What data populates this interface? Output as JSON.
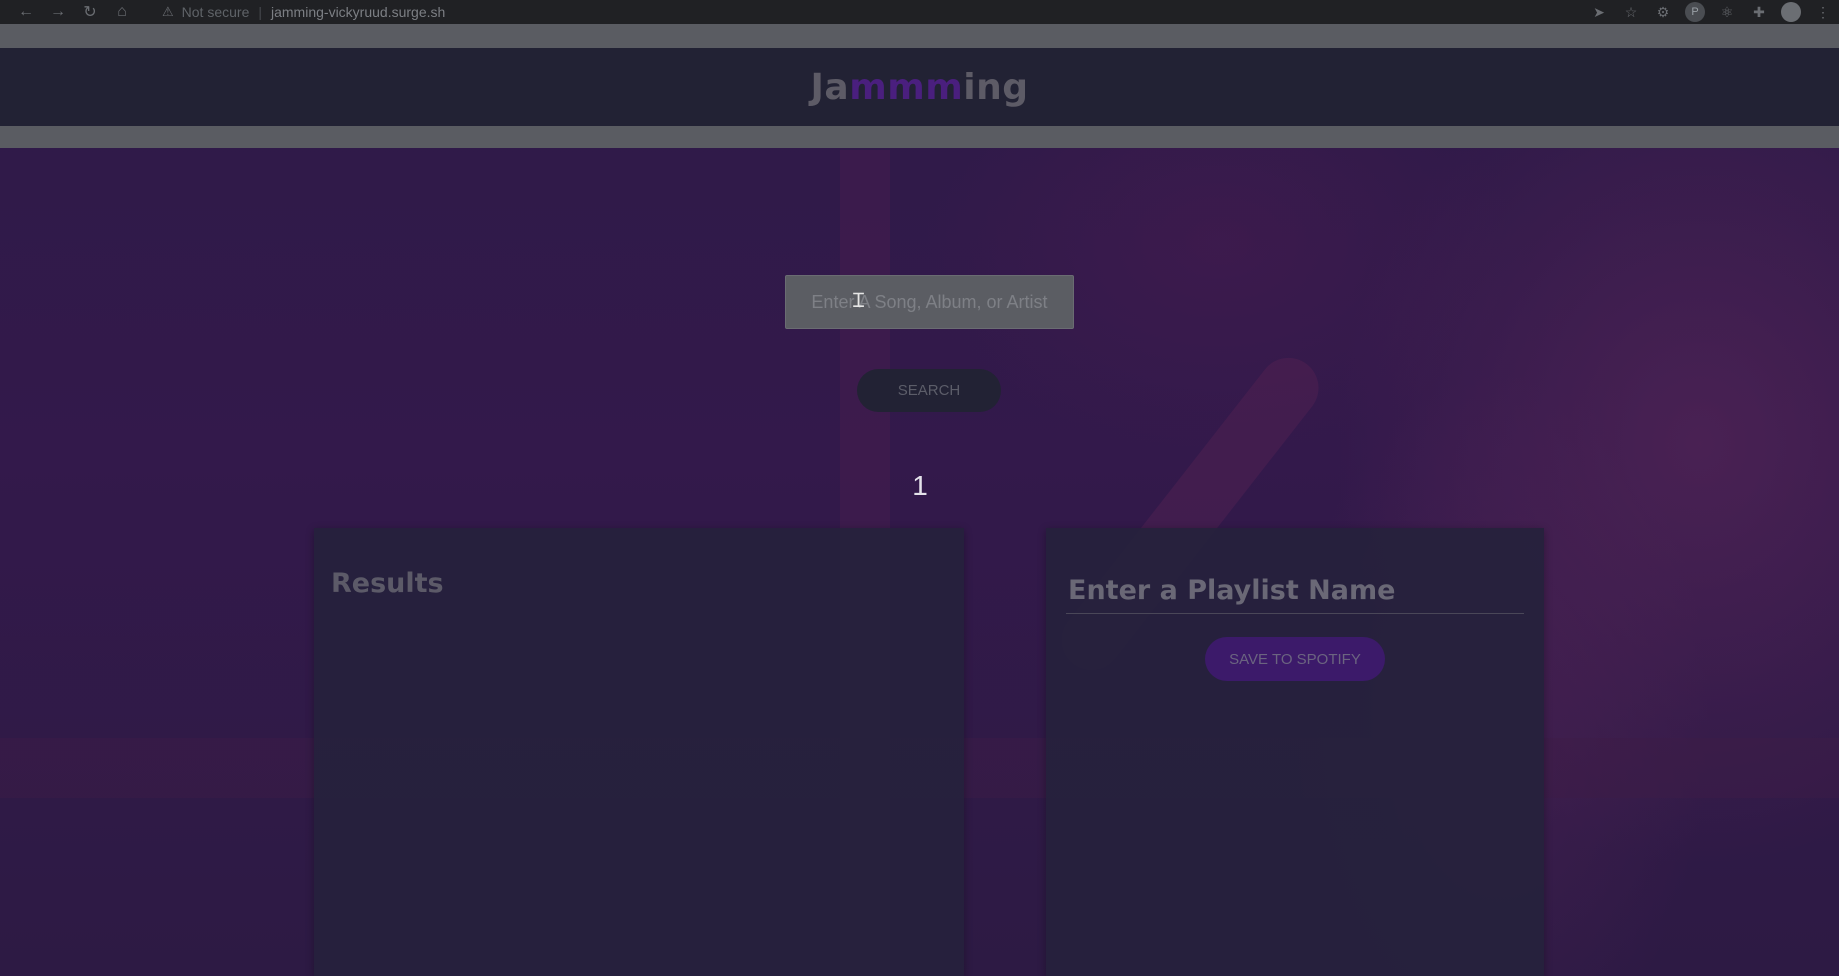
{
  "browser": {
    "security_text": "Not secure",
    "url": "jamming-vickyruud.surge.sh"
  },
  "header": {
    "logo_prefix": "Ja",
    "logo_highlight": "mmm",
    "logo_suffix": "ing",
    "highlight_color": "#4a1f7e"
  },
  "search": {
    "placeholder": "Enter A Song, Album, or Artist",
    "button_label": "SEARCH"
  },
  "counter": "1",
  "results": {
    "title": "Results"
  },
  "playlist": {
    "name_placeholder": "Enter a Playlist Name",
    "save_label": "SAVE TO SPOTIFY"
  },
  "colors": {
    "overlay_header": "#222234",
    "accent_purple": "#3c1a6a",
    "page_bg": "#2c1a44"
  }
}
